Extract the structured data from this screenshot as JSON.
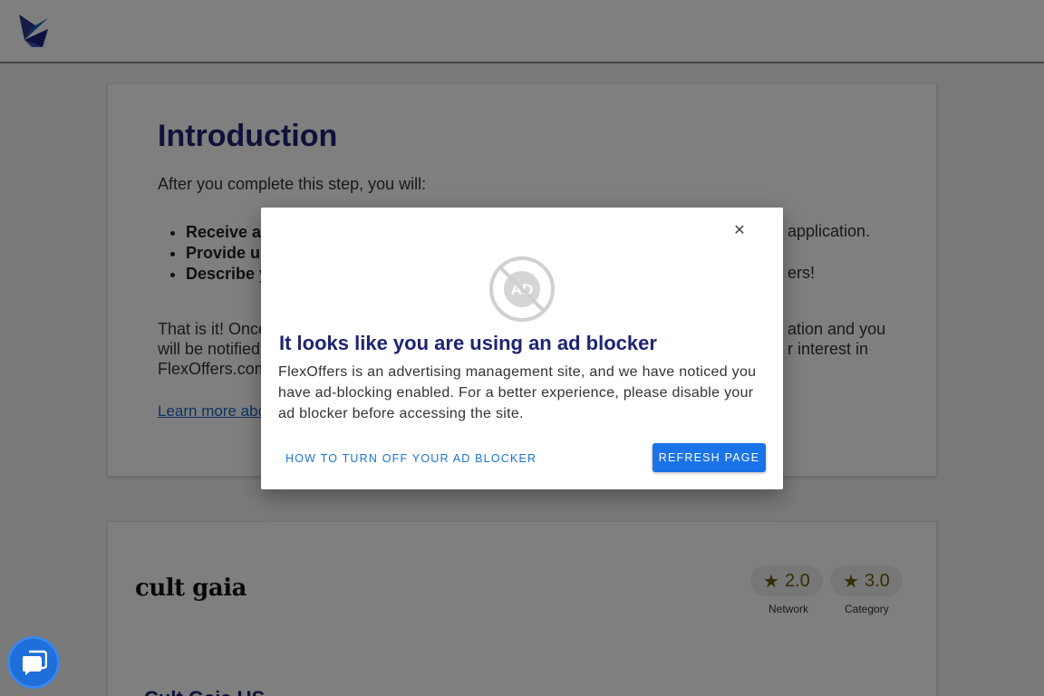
{
  "header": {
    "logo_icon": "flexoffers-logo-icon"
  },
  "intro": {
    "title": "Introduction",
    "subtitle": "After you complete this step, you will:",
    "list_items": [
      "Receive an",
      "Provide us",
      "Describe y"
    ],
    "list_right_fragments": [
      "application.",
      "ers!"
    ],
    "body_left": "That is it! Once\nwill be notified o\nFlexOffers.com",
    "body_right": "ation and you\nr interest in",
    "link": "Learn more abo"
  },
  "merchant": {
    "brand_name": "cult gaia",
    "network_rating": "2.0",
    "network_label": "Network",
    "category_rating": "3.0",
    "category_label": "Category",
    "title_fragment": "Cult Gaia US"
  },
  "modal": {
    "close_icon": "close-icon",
    "icon": "ad-blocker-icon",
    "title": "It looks like you are using an ad blocker",
    "body": "FlexOffers is an advertising management site, and we have noticed you have ad-blocking enabled. For a better experience, please disable your ad blocker before accessing the site.",
    "howto_label": "HOW TO TURN OFF YOUR AD BLOCKER",
    "refresh_label": "REFRESH PAGE"
  },
  "chat": {
    "icon": "chat-bubble-icon"
  },
  "colors": {
    "title": "#1d2474",
    "primary": "#1a73e8",
    "overlay": "rgba(0,0,0,0.5)"
  }
}
